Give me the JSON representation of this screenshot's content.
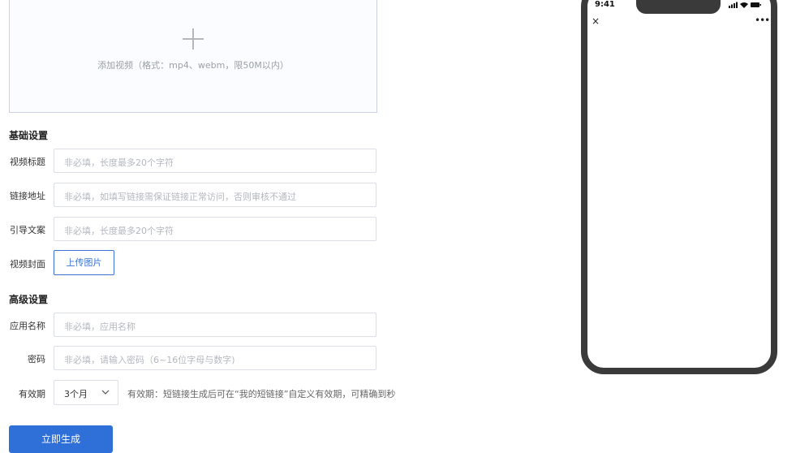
{
  "upload": {
    "hint": "添加视频（格式：mp4、webm，限50M以内）"
  },
  "basic": {
    "title": "基础设置",
    "video_title": {
      "label": "视频标题",
      "placeholder": "非必填，长度最多20个字符"
    },
    "link": {
      "label": "链接地址",
      "placeholder": "非必填，如填写链接需保证链接正常访问，否则审核不通过"
    },
    "guide": {
      "label": "引导文案",
      "placeholder": "非必填，长度最多20个字符"
    },
    "cover": {
      "label": "视频封面",
      "button": "上传图片"
    }
  },
  "advanced": {
    "title": "高级设置",
    "app_name": {
      "label": "应用名称",
      "placeholder": "非必填，应用名称"
    },
    "password": {
      "label": "密码",
      "placeholder": "非必填，请输入密码（6~16位字母与数字)"
    },
    "validity": {
      "label": "有效期",
      "selected": "3个月",
      "hint": "有效期：短链接生成后可在“我的短链接”自定义有效期，可精确到秒"
    }
  },
  "submit_label": "立即生成",
  "phone": {
    "time": "9:41",
    "close": "×",
    "more": "•••"
  },
  "colors": {
    "accent": "#2e6fd8",
    "phone_frame": "#3a3a3a"
  }
}
